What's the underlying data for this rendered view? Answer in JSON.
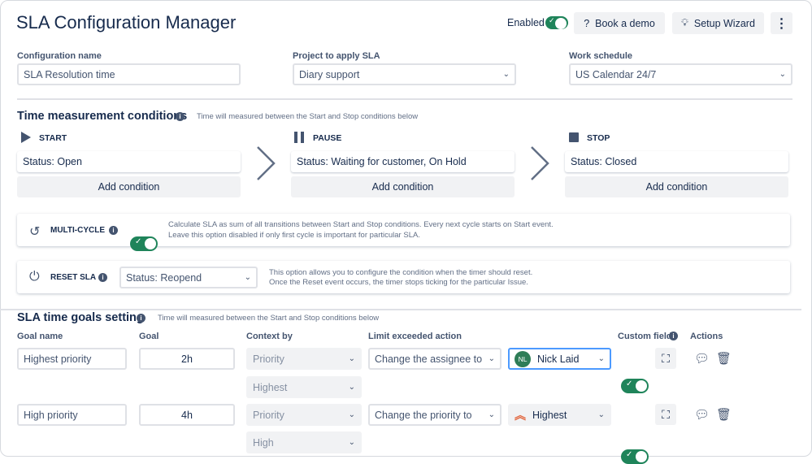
{
  "header": {
    "title": "SLA Configuration Manager",
    "enabled_label": "Enabled",
    "enabled": true,
    "book_demo": "Book a demo",
    "setup_wizard": "Setup Wizard"
  },
  "config": {
    "name_label": "Configuration name",
    "name_value": "SLA Resolution time",
    "project_label": "Project to apply SLA",
    "project_value": "Diary support",
    "schedule_label": "Work schedule",
    "schedule_value": "US Calendar 24/7"
  },
  "time": {
    "title": "Time measurement conditions",
    "help": "Time will measured between the Start and Stop conditions below",
    "columns": [
      {
        "label": "START",
        "status": "Status: Open",
        "add": "Add condition"
      },
      {
        "label": "PAUSE",
        "status": "Status: Waiting for customer, On Hold",
        "add": "Add condition"
      },
      {
        "label": "STOP",
        "status": "Status: Closed",
        "add": "Add condition"
      }
    ]
  },
  "multicycle": {
    "label": "MULTI-CYCLE",
    "enabled": true,
    "line1": "Calculate SLA as sum of all transitions between Start and Stop conditions. Every next cycle starts on Start event.",
    "line2": "Leave this option disabled if only first cycle is important for particular SLA."
  },
  "reset": {
    "label": "RESET SLA",
    "value": "Status: Reopend",
    "line1": "This option allows you to configure the condition when the timer should reset.",
    "line2": "Once the Reset event occurs, the timer stops ticking for the particular Issue."
  },
  "goals": {
    "title": "SLA time goals setting",
    "help": "Time will measured between the Start and Stop conditions below",
    "headers": {
      "name": "Goal name",
      "goal": "Goal",
      "context": "Context by",
      "limit": "Limit exceeded action",
      "custom": "Custom field",
      "actions": "Actions"
    },
    "rows": [
      {
        "name": "Highest priority",
        "goal": "2h",
        "context": "Priority",
        "context2": "Highest",
        "action": "Change the assignee to",
        "target": "Nick Laid",
        "initials": "NL",
        "custom": true
      },
      {
        "name": "High priority",
        "goal": "4h",
        "context": "Priority",
        "context2": "High",
        "action": "Change the priority to",
        "target": "Highest",
        "custom": true
      }
    ]
  },
  "colors": {
    "accent": "#1f845a",
    "avatar": "#2e7d57",
    "priority": "#e2673f"
  }
}
